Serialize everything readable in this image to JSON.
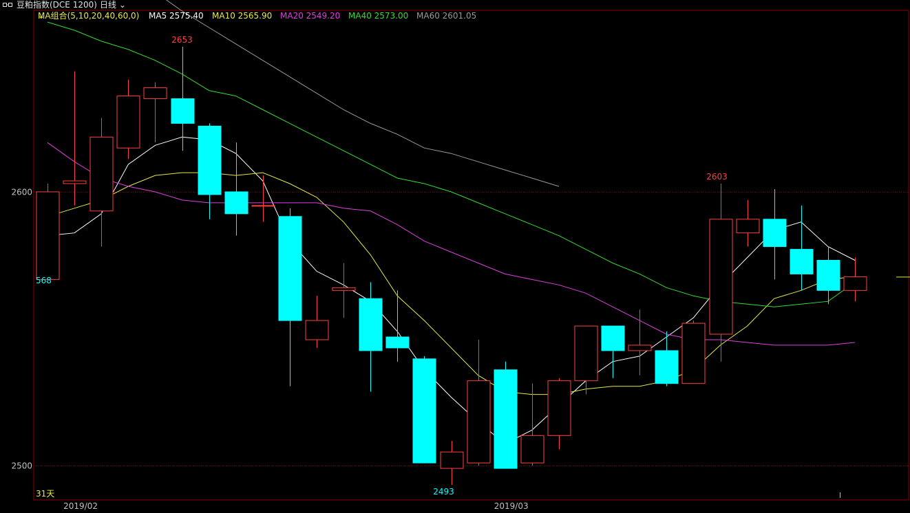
{
  "header": {
    "title": "豆粕指数(DCE 1200)",
    "period": "日线"
  },
  "ma_legend": {
    "group": "MA组合(5,10,20,40,60,0)",
    "items": [
      {
        "label": "MA5 2575.40",
        "color": "#ffffff"
      },
      {
        "label": "MA10 2565.90",
        "color": "#e8e84a"
      },
      {
        "label": "MA20 2549.20",
        "color": "#e040e0"
      },
      {
        "label": "MA40 2573.00",
        "color": "#33dd33"
      },
      {
        "label": "MA60 2601.05",
        "color": "#9a9a9a"
      }
    ]
  },
  "colors": {
    "up": "#ff4040",
    "down": "#00ffff",
    "grid": "#8b0000",
    "axis_text": "#c0c0c0",
    "count_label": "#e8e84a"
  },
  "chart_data": {
    "type": "candlestick",
    "ylim": [
      2492,
      2658
    ],
    "yticks": [
      2500,
      2600
    ],
    "xticks": [
      {
        "index": 1,
        "label": "2019/02"
      },
      {
        "index": 17,
        "label": "2019/03"
      }
    ],
    "annotations": {
      "high": {
        "index": 5,
        "value": 2653,
        "label": "2653"
      },
      "low": {
        "index": 15,
        "value": 2493,
        "label": "2493"
      },
      "recent_high": {
        "index": 25,
        "value": 2603,
        "label": "2603"
      },
      "left_value": {
        "index": 0,
        "label": "568"
      }
    },
    "bar_count_label": "31天",
    "candles": [
      {
        "open": 2568,
        "high": 2603,
        "low": 2568,
        "close": 2600
      },
      {
        "open": 2603,
        "high": 2644,
        "low": 2595,
        "close": 2604
      },
      {
        "open": 2593,
        "high": 2627,
        "low": 2580,
        "close": 2620
      },
      {
        "open": 2616,
        "high": 2641,
        "low": 2612,
        "close": 2635
      },
      {
        "open": 2634,
        "high": 2640,
        "low": 2618,
        "close": 2638
      },
      {
        "open": 2634,
        "high": 2653,
        "low": 2615,
        "close": 2625
      },
      {
        "open": 2624,
        "high": 2625,
        "low": 2590,
        "close": 2599
      },
      {
        "open": 2600,
        "high": 2618,
        "low": 2584,
        "close": 2592
      },
      {
        "open": 2595,
        "high": 2606,
        "low": 2589,
        "close": 2595
      },
      {
        "open": 2591,
        "high": 2594,
        "low": 2529,
        "close": 2553
      },
      {
        "open": 2546,
        "high": 2562,
        "low": 2543,
        "close": 2553
      },
      {
        "open": 2564,
        "high": 2574,
        "low": 2554,
        "close": 2565
      },
      {
        "open": 2561,
        "high": 2567,
        "low": 2527,
        "close": 2542
      },
      {
        "open": 2547,
        "high": 2564,
        "low": 2538,
        "close": 2543
      },
      {
        "open": 2539,
        "high": 2540,
        "low": 2501,
        "close": 2501
      },
      {
        "open": 2499,
        "high": 2509,
        "low": 2493,
        "close": 2505
      },
      {
        "open": 2501,
        "high": 2546,
        "low": 2500,
        "close": 2531
      },
      {
        "open": 2535,
        "high": 2538,
        "low": 2499,
        "close": 2499
      },
      {
        "open": 2501,
        "high": 2530,
        "low": 2500,
        "close": 2511
      },
      {
        "open": 2511,
        "high": 2532,
        "low": 2506,
        "close": 2531
      },
      {
        "open": 2531,
        "high": 2551,
        "low": 2526,
        "close": 2551
      },
      {
        "open": 2551,
        "high": 2551,
        "low": 2532,
        "close": 2542
      },
      {
        "open": 2542,
        "high": 2557,
        "low": 2533,
        "close": 2544
      },
      {
        "open": 2542,
        "high": 2549,
        "low": 2529,
        "close": 2530
      },
      {
        "open": 2530,
        "high": 2553,
        "low": 2530,
        "close": 2552
      },
      {
        "open": 2548,
        "high": 2603,
        "low": 2538,
        "close": 2590
      },
      {
        "open": 2585,
        "high": 2597,
        "low": 2580,
        "close": 2590
      },
      {
        "open": 2590,
        "high": 2601,
        "low": 2568,
        "close": 2580
      },
      {
        "open": 2579,
        "high": 2595,
        "low": 2564,
        "close": 2570
      },
      {
        "open": 2575,
        "high": 2580,
        "low": 2559,
        "close": 2564
      },
      {
        "open": 2564,
        "high": 2576,
        "low": 2560,
        "close": 2569
      }
    ],
    "series": [
      {
        "name": "MA5",
        "color": "#ffffff",
        "values": [
          2584,
          2585,
          2592,
          2610,
          2617,
          2620,
          2619,
          2614,
          2604,
          2582,
          2571,
          2566,
          2560,
          2549,
          2535,
          2525,
          2516,
          2508,
          2513,
          2522,
          2531,
          2538,
          2540,
          2547,
          2554,
          2566,
          2576,
          2586,
          2589,
          2580,
          2575
        ]
      },
      {
        "name": "MA10",
        "color": "#e8e84a",
        "values": [
          2591,
          2594,
          2597,
          2602,
          2606,
          2607,
          2607,
          2606,
          2607,
          2603,
          2598,
          2589,
          2577,
          2562,
          2553,
          2543,
          2533,
          2527,
          2526,
          2526,
          2528,
          2529,
          2529,
          2531,
          2535,
          2544,
          2551,
          2561,
          2564,
          2568,
          2569
        ]
      },
      {
        "name": "MA20",
        "color": "#e040e0",
        "values": [
          2618,
          2611,
          2605,
          2602,
          2600,
          2597,
          2596,
          2596,
          2596,
          2596,
          2596,
          2594,
          2593,
          2588,
          2582,
          2578,
          2574,
          2570,
          2568,
          2566,
          2563,
          2558,
          2553,
          2548,
          2546,
          2546,
          2545,
          2544,
          2544,
          2544,
          2545
        ]
      },
      {
        "name": "MA40",
        "color": "#33dd33",
        "values": [
          2662,
          2659,
          2655,
          2652,
          2648,
          2643,
          2637,
          2635,
          2630,
          2625,
          2620,
          2615,
          2610,
          2605,
          2603,
          2600,
          2596,
          2592,
          2588,
          2584,
          2579,
          2574,
          2570,
          2565,
          2562,
          2560,
          2559,
          2558,
          2559,
          2560,
          2567
        ]
      },
      {
        "name": "MA60",
        "color": "#9a9a9a",
        "values": [
          2689,
          2686,
          2682,
          2678,
          2673,
          2666,
          2660,
          2654,
          2648,
          2642,
          2636,
          2630,
          2625,
          2621,
          2616,
          2614,
          2611,
          2608,
          2605,
          2602
        ]
      }
    ]
  }
}
